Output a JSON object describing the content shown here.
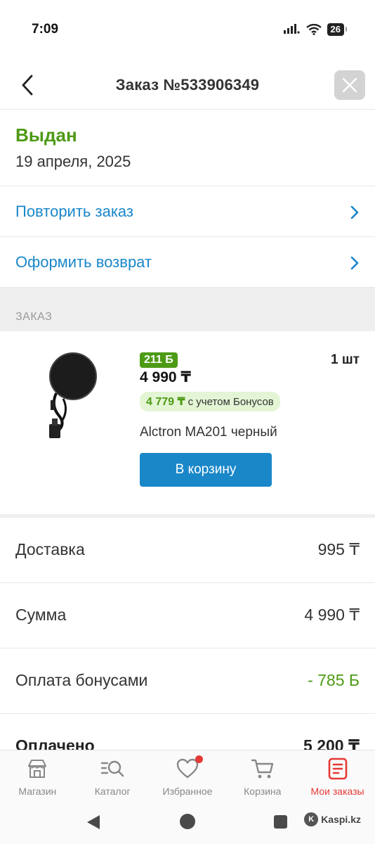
{
  "status_bar": {
    "time": "7:09",
    "battery": "26"
  },
  "header": {
    "title": "Заказ №533906349"
  },
  "order": {
    "status": "Выдан",
    "date": "19 апреля, 2025"
  },
  "actions": [
    {
      "label": "Повторить заказ"
    },
    {
      "label": "Оформить возврат"
    }
  ],
  "section": {
    "title": "ЗАКАЗ"
  },
  "item": {
    "bonus_badge": "211 Б",
    "price": "4 990 ₸",
    "quantity": "1 шт",
    "bonus_price": "4 779 ₸",
    "bonus_text": "с учетом Бонусов",
    "name": "Alctron MA201 черный",
    "cart_button": "В корзину"
  },
  "summary": {
    "delivery": {
      "label": "Доставка",
      "value": "995 ₸"
    },
    "sum": {
      "label": "Сумма",
      "value": "4 990 ₸"
    },
    "bonus_payment": {
      "label": "Оплата бонусами",
      "value": "- 785 Б"
    },
    "paid": {
      "label": "Оплачено",
      "value": "5 200 ₸"
    }
  },
  "bottom_nav": [
    {
      "label": "Магазин",
      "icon": "store-icon"
    },
    {
      "label": "Каталог",
      "icon": "catalog-search-icon"
    },
    {
      "label": "Избранное",
      "icon": "heart-icon"
    },
    {
      "label": "Корзина",
      "icon": "cart-icon"
    },
    {
      "label": "Мои заказы",
      "icon": "orders-icon",
      "active": true
    }
  ],
  "watermark": {
    "text": "Kaspi.kz"
  },
  "colors": {
    "accent_blue": "#1a87c9",
    "success_green": "#4d9a14",
    "active_red": "#e53935"
  }
}
